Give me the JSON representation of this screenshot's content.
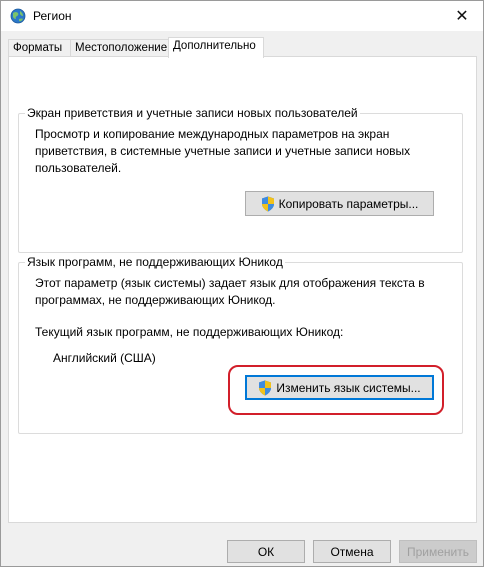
{
  "window": {
    "title": "Регион",
    "close_glyph": "✕"
  },
  "tabs": [
    {
      "label": "Форматы",
      "active": false
    },
    {
      "label": "Местоположение",
      "active": false
    },
    {
      "label": "Дополнительно",
      "active": true
    }
  ],
  "welcome_group": {
    "title": "Экран приветствия и учетные записи новых пользователей",
    "description_lines": [
      "Просмотр и копирование международных параметров на экран",
      "приветствия, в системные учетные записи и учетные записи новых",
      "пользователей."
    ],
    "button_label": "Копировать параметры..."
  },
  "unicode_group": {
    "title": "Язык программ, не поддерживающих Юникод",
    "description_lines": [
      "Этот параметр (язык системы) задает язык для отображения текста в",
      "программах, не поддерживающих Юникод."
    ],
    "current_label": "Текущий язык программ, не поддерживающих Юникод:",
    "current_value": "Английский (США)",
    "button_label": "Изменить язык системы..."
  },
  "footer": {
    "ok_label": "ОК",
    "cancel_label": "Отмена",
    "apply_label": "Применить"
  },
  "colors": {
    "highlight": "#d21f2a",
    "focus_border": "#0078d7"
  },
  "icons": {
    "app": "globe-icon",
    "shield": "uac-shield-icon"
  }
}
